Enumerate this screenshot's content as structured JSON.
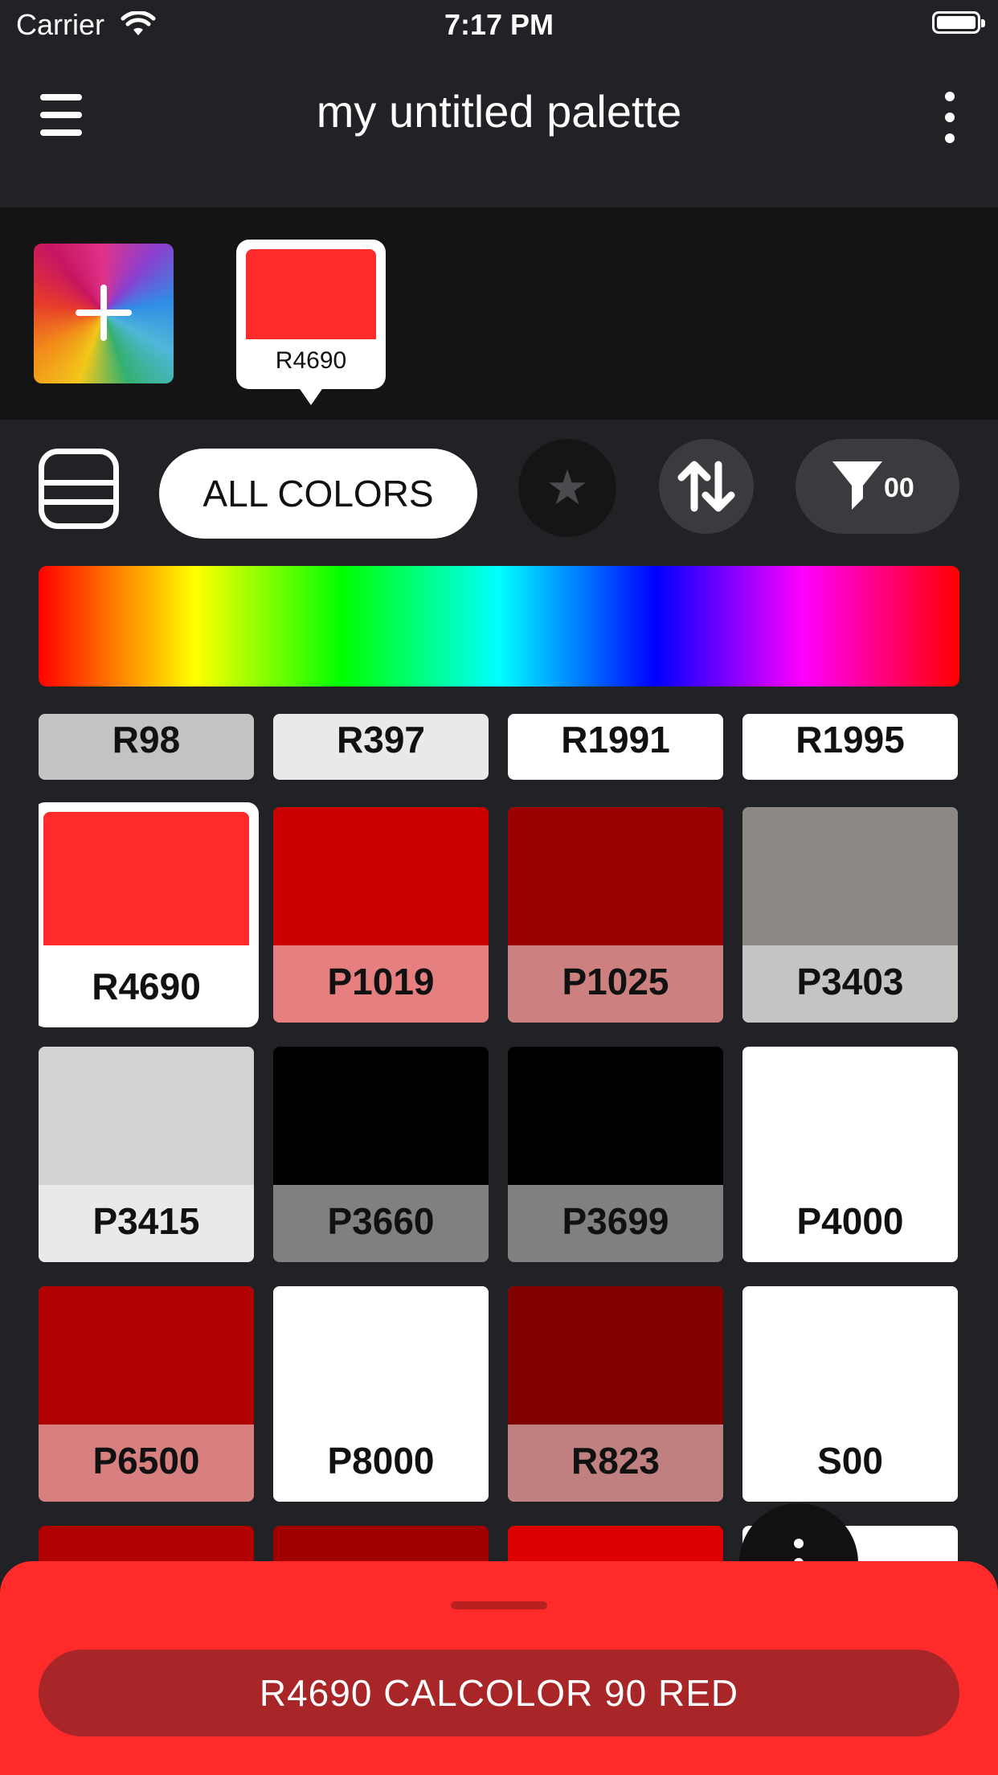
{
  "status_bar": {
    "carrier": "Carrier",
    "time": "7:17 PM"
  },
  "header": {
    "title": "my untitled palette"
  },
  "palette_strip": {
    "selected_code": "R4690",
    "selected_color": "#ff2b2b"
  },
  "filters": {
    "all_colors_label": "ALL COLORS",
    "filter_count": "00"
  },
  "grid": {
    "top_row": [
      {
        "code": "R98",
        "label_bg": "#c5c3c1"
      },
      {
        "code": "R397",
        "label_bg": "#e9e9e9"
      },
      {
        "code": "R1991",
        "label_bg": "#ffffff"
      },
      {
        "code": "R1995",
        "label_bg": "#ffffff"
      }
    ],
    "rows": [
      [
        {
          "code": "R4690",
          "swatch": "#ff2b2b",
          "label_bg": "#ffffff",
          "selected": true
        },
        {
          "code": "P1019",
          "swatch": "#cc0000",
          "label_bg": "#e68080"
        },
        {
          "code": "P1025",
          "swatch": "#990000",
          "label_bg": "#cc8080"
        },
        {
          "code": "P3403",
          "swatch": "#8c8886",
          "label_bg": "#c6c4c2"
        }
      ],
      [
        {
          "code": "P3415",
          "swatch": "#d3d3d3",
          "label_bg": "#e9e9e9"
        },
        {
          "code": "P3660",
          "swatch": "#000000",
          "label_bg": "#808080"
        },
        {
          "code": "P3699",
          "swatch": "#000000",
          "label_bg": "#808080"
        },
        {
          "code": "P4000",
          "swatch": "#ffffff",
          "label_bg": "#ffffff"
        }
      ],
      [
        {
          "code": "P6500",
          "swatch": "#b00000",
          "label_bg": "#d88080"
        },
        {
          "code": "P8000",
          "swatch": "#ffffff",
          "label_bg": "#ffffff"
        },
        {
          "code": "R823",
          "swatch": "#800000",
          "label_bg": "#c08080"
        },
        {
          "code": "S00",
          "swatch": "#ffffff",
          "label_bg": "#ffffff"
        }
      ]
    ],
    "partial_row": [
      "#b00000",
      "#a00000",
      "#dd0000",
      "#ffffff"
    ]
  },
  "bottom_sheet": {
    "color_name": "R4690 CALCOLOR 90 RED"
  }
}
